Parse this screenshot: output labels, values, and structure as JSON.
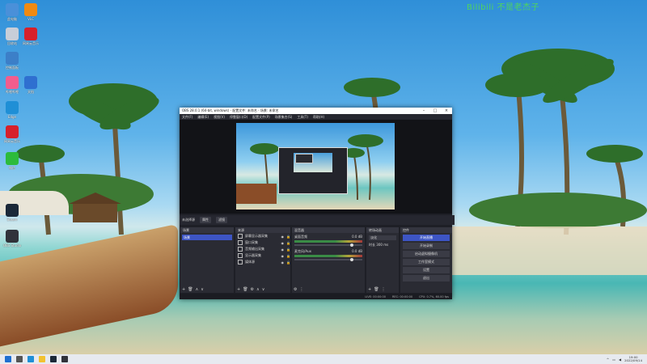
{
  "watermark": "Bilibili 不是老杰子",
  "desktop_icons": [
    {
      "label": "此电脑",
      "color": "#4a90d9"
    },
    {
      "label": "回收站",
      "color": "#c8ced8"
    },
    {
      "label": "控制面板",
      "color": "#3c7fc8"
    },
    {
      "label": "哔哩哔哩",
      "color": "#f25d8e"
    },
    {
      "label": "Edge",
      "color": "#1f8fd6"
    },
    {
      "label": "网易云音乐",
      "color": "#d6202b"
    },
    {
      "label": "微信",
      "color": "#2dbb3c"
    },
    {
      "label": "Steam",
      "color": "#1b2838"
    },
    {
      "label": "OBS Studio",
      "color": "#30323a"
    },
    {
      "label": "VLC",
      "color": "#f08a12"
    },
    {
      "label": "网易云音乐",
      "color": "#d6202b"
    },
    {
      "label": "文档",
      "color": "#2f6fd0"
    }
  ],
  "obs": {
    "title": "OBS 28.0.1 (64-bit, windows) - 配置文件: 未命名 - 场景: 未命名",
    "menu": [
      "文件(F)",
      "编辑(E)",
      "视图(V)",
      "停靠窗口(D)",
      "配置文件(P)",
      "场景集合(S)",
      "工具(T)",
      "帮助(H)"
    ],
    "context": {
      "selected": "未选择源",
      "properties": "属性",
      "filters": "滤镜"
    },
    "docks": {
      "scenes": {
        "header": "场景",
        "items": [
          "场景"
        ]
      },
      "sources": {
        "header": "来源",
        "items": [
          "屏幕显示器采集",
          "窗口采集",
          "音频输出采集",
          "显示器采集",
          "媒体源"
        ]
      },
      "mixer": {
        "header": "混音器",
        "tracks": [
          {
            "name": "桌面音频",
            "db": "0.0 dB",
            "level": 0.85
          },
          {
            "name": "麦克风/Aux",
            "db": "0.0 dB",
            "level": 0.85
          }
        ]
      },
      "transitions": {
        "header": "转场动画",
        "type": "淡化",
        "duration_label": "时长",
        "duration": "300 ms"
      },
      "controls": {
        "header": "控件",
        "buttons": [
          "开始直播",
          "开始录制",
          "启动虚拟摄像机",
          "工作室模式",
          "设置",
          "退出"
        ]
      }
    },
    "status": {
      "live": "LIVE: 00:00:00",
      "rec": "REC: 00:00:00",
      "cpu": "CPU: 0.7%, 60.00 fps"
    }
  },
  "taskbar": {
    "icons": [
      {
        "name": "windows-start-icon",
        "color": "#1f6fd0"
      },
      {
        "name": "search-icon",
        "color": "#555"
      },
      {
        "name": "edge-icon",
        "color": "#1f8fd6"
      },
      {
        "name": "file-explorer-icon",
        "color": "#f2c230"
      },
      {
        "name": "steam-icon",
        "color": "#1b2838"
      },
      {
        "name": "obs-icon",
        "color": "#30323a"
      }
    ],
    "time": "19:00",
    "date": "2022/09/14"
  }
}
